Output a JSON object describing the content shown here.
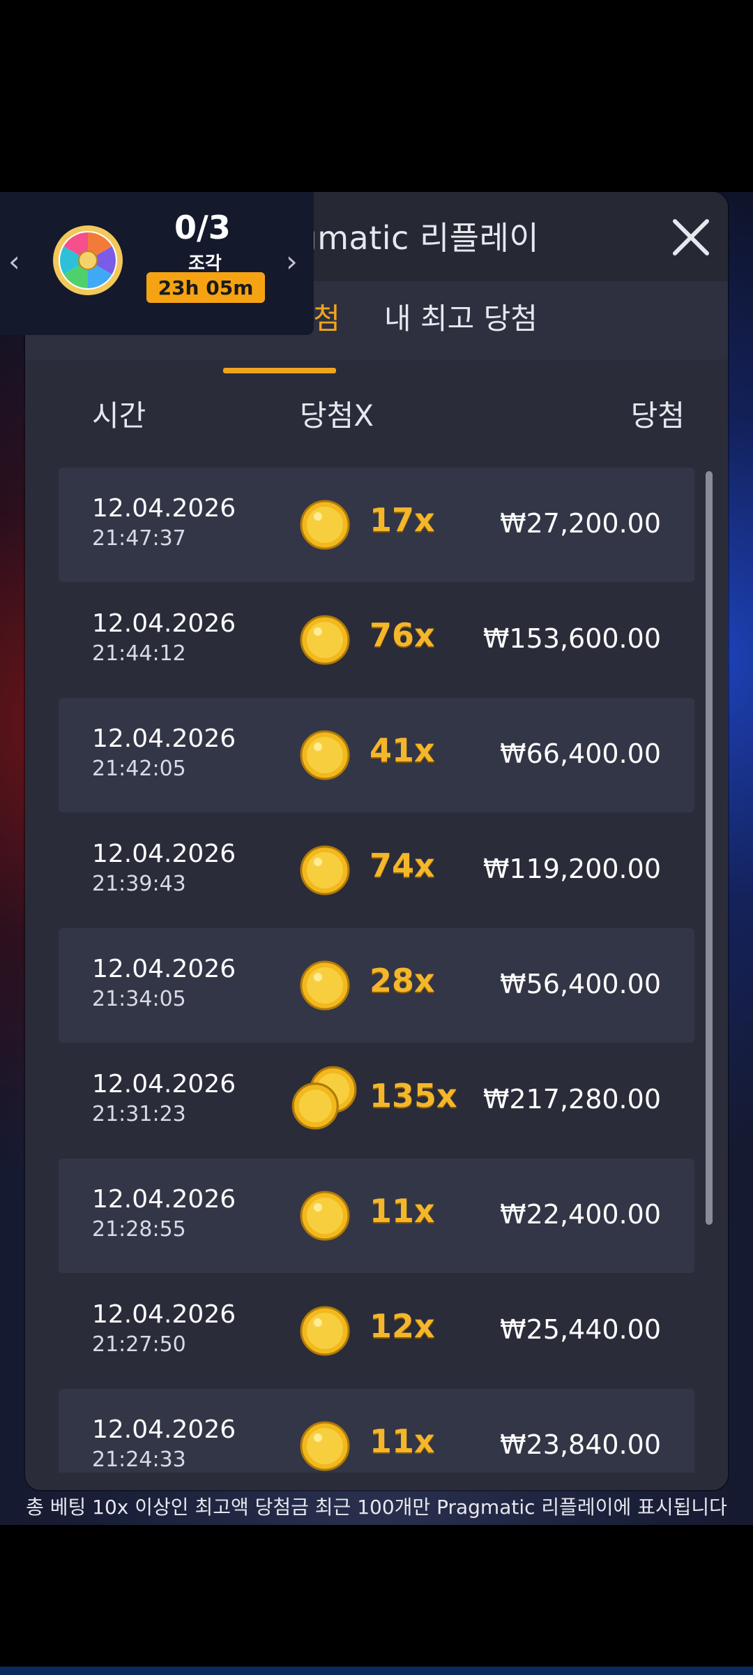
{
  "panel": {
    "title": "Pragmatic 리플레이",
    "tabs": {
      "latest": "최신 당첨",
      "best": "내 최고 당첨"
    },
    "columns": {
      "time": "시간",
      "multiplier": "당첨X",
      "win": "당첨"
    },
    "rows": [
      {
        "date": "12.04.2026",
        "time": "21:47:37",
        "multiplier": "17x",
        "amount": "₩27,200.00"
      },
      {
        "date": "12.04.2026",
        "time": "21:44:12",
        "multiplier": "76x",
        "amount": "₩153,600.00"
      },
      {
        "date": "12.04.2026",
        "time": "21:42:05",
        "multiplier": "41x",
        "amount": "₩66,400.00"
      },
      {
        "date": "12.04.2026",
        "time": "21:39:43",
        "multiplier": "74x",
        "amount": "₩119,200.00"
      },
      {
        "date": "12.04.2026",
        "time": "21:34:05",
        "multiplier": "28x",
        "amount": "₩56,400.00"
      },
      {
        "date": "12.04.2026",
        "time": "21:31:23",
        "multiplier": "135x",
        "amount": "₩217,280.00"
      },
      {
        "date": "12.04.2026",
        "time": "21:28:55",
        "multiplier": "11x",
        "amount": "₩22,400.00"
      },
      {
        "date": "12.04.2026",
        "time": "21:27:50",
        "multiplier": "12x",
        "amount": "₩25,440.00"
      },
      {
        "date": "12.04.2026",
        "time": "21:24:33",
        "multiplier": "11x",
        "amount": "₩23,840.00"
      }
    ],
    "footnote": "총 베팅 10x 이상인 최고액 당첨금 최근 100개만 Pragmatic 리플레이에 표시됩니다"
  },
  "wheel_card": {
    "progress": "0/3",
    "pieces_label": "조각",
    "timer": "23h 05m"
  },
  "colors": {
    "accent": "#f0a51c",
    "panel": "#2a2c3a",
    "row_dark": "#333646"
  },
  "icons": {
    "close": "close-icon",
    "coin": "coin-icon",
    "wheel": "wheel-icon"
  }
}
